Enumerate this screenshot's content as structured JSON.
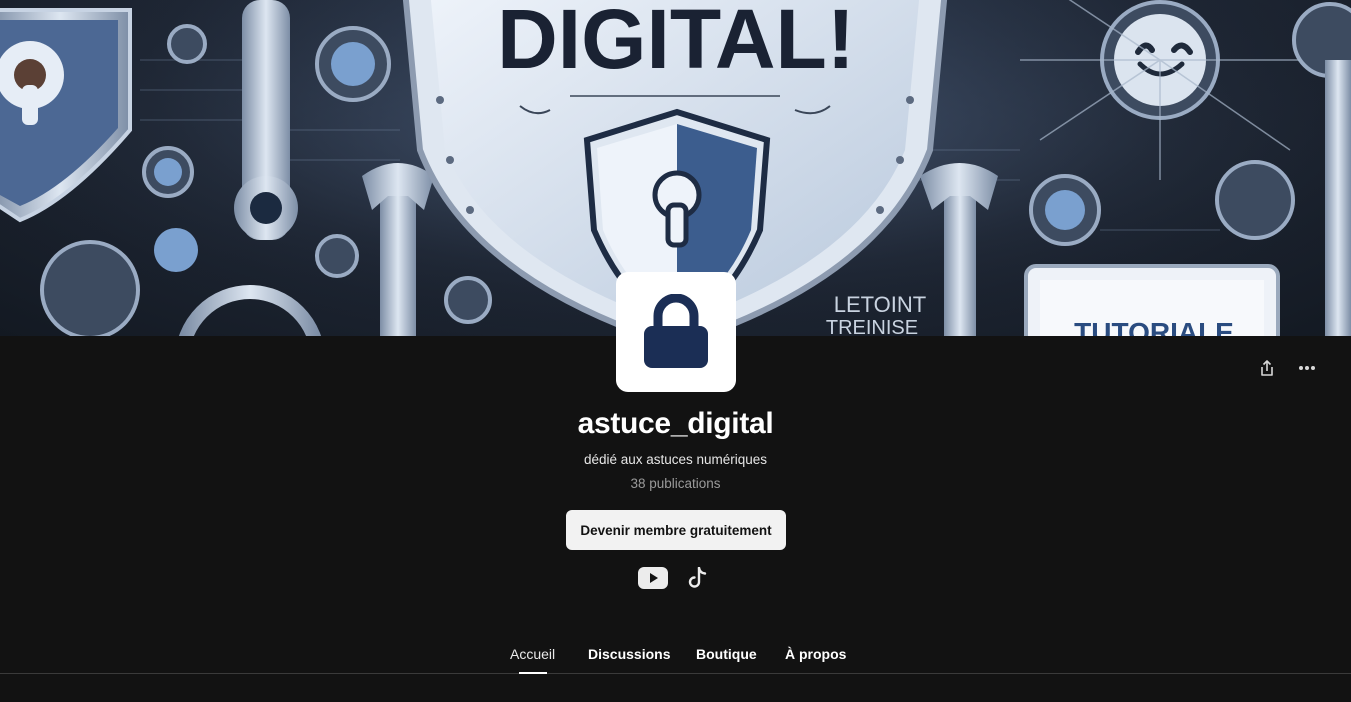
{
  "banner": {
    "text_large": "DIGITAL!",
    "text_small_1": "LETOINT",
    "text_small_2": "TREINISE",
    "text_screen": "TUTORIALE"
  },
  "profile": {
    "name": "astuce_digital",
    "tagline": "dédié aux astuces numériques",
    "post_count": "38 publications",
    "join_label": "Devenir membre gratuitement"
  },
  "avatar": {
    "icon": "lock-icon",
    "color": "#1b2e55"
  },
  "actions": {
    "share_icon": "share-icon",
    "more_icon": "more-icon"
  },
  "social": [
    "youtube-icon",
    "tiktok-icon"
  ],
  "tabs": [
    {
      "label": "Accueil",
      "active": true
    },
    {
      "label": "Discussions",
      "active": false
    },
    {
      "label": "Boutique",
      "active": false
    },
    {
      "label": "À propos",
      "active": false
    }
  ],
  "colors": {
    "background": "#121212",
    "accent": "#ffffff",
    "button_bg": "#f2f2f2",
    "lock": "#1b2e55"
  }
}
